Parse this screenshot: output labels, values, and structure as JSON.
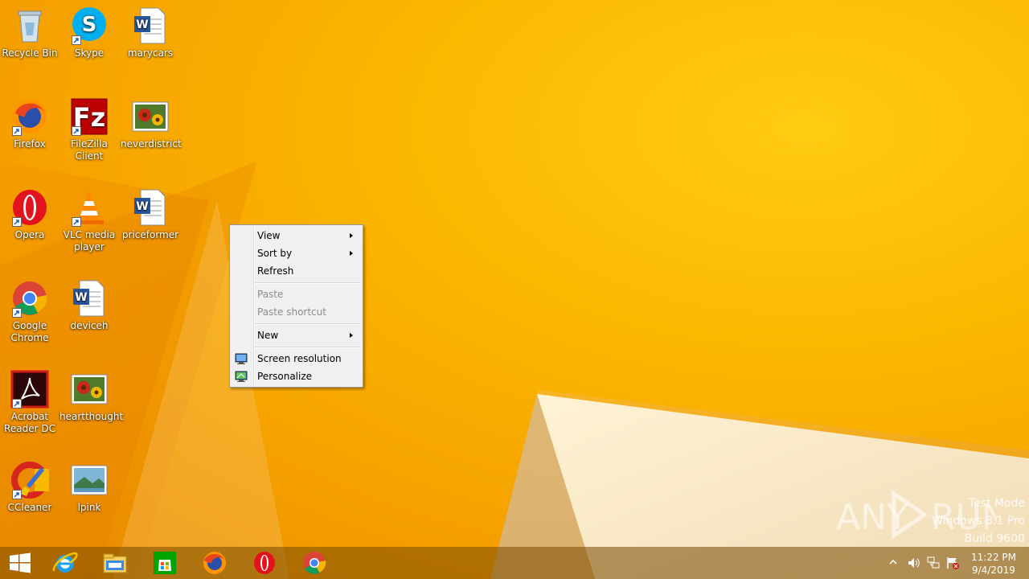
{
  "desktop": {
    "icons": [
      {
        "label": "Recycle Bin",
        "icon": "recycle-bin-icon"
      },
      {
        "label": "Skype",
        "icon": "skype-icon"
      },
      {
        "label": "marycars",
        "icon": "word-document-icon"
      },
      {
        "label": "Firefox",
        "icon": "firefox-icon"
      },
      {
        "label": "FileZilla Client",
        "icon": "filezilla-icon"
      },
      {
        "label": "neverdistrict",
        "icon": "image-file-icon"
      },
      {
        "label": "Opera",
        "icon": "opera-icon"
      },
      {
        "label": "VLC media player",
        "icon": "vlc-icon"
      },
      {
        "label": "priceformer",
        "icon": "word-document-icon"
      },
      {
        "label": "Google Chrome",
        "icon": "chrome-icon"
      },
      {
        "label": "deviceh",
        "icon": "word-document-icon"
      },
      {
        "label": "Acrobat Reader DC",
        "icon": "acrobat-icon"
      },
      {
        "label": "heartthought",
        "icon": "image-file-icon"
      },
      {
        "label": "CCleaner",
        "icon": "ccleaner-icon"
      },
      {
        "label": "lpink",
        "icon": "image-file-icon"
      }
    ]
  },
  "context_menu": {
    "items": [
      {
        "label": "View",
        "submenu": true,
        "enabled": true
      },
      {
        "label": "Sort by",
        "submenu": true,
        "enabled": true
      },
      {
        "label": "Refresh",
        "submenu": false,
        "enabled": true
      },
      {
        "label": "Paste",
        "submenu": false,
        "enabled": false
      },
      {
        "label": "Paste shortcut",
        "submenu": false,
        "enabled": false
      },
      {
        "label": "New",
        "submenu": true,
        "enabled": true
      },
      {
        "label": "Screen resolution",
        "icon": "display-icon",
        "enabled": true
      },
      {
        "label": "Personalize",
        "icon": "personalize-icon",
        "enabled": true
      }
    ]
  },
  "taskbar": {
    "pinned": [
      "start-icon",
      "internet-explorer-icon",
      "file-explorer-icon",
      "store-icon",
      "firefox-icon",
      "opera-icon",
      "chrome-icon"
    ],
    "clock": {
      "time": "11:22 PM",
      "date": "9/4/2019"
    }
  },
  "watermark": {
    "brand": "ANY RUN",
    "line1": "Test Mode",
    "line2": "Windows 8.1 Pro",
    "line3": "Build 9600"
  },
  "colors": {
    "wallpaper_main": "#fbb800",
    "wallpaper_dark": "#e88a00",
    "menu_bg": "#f0f0f0"
  }
}
